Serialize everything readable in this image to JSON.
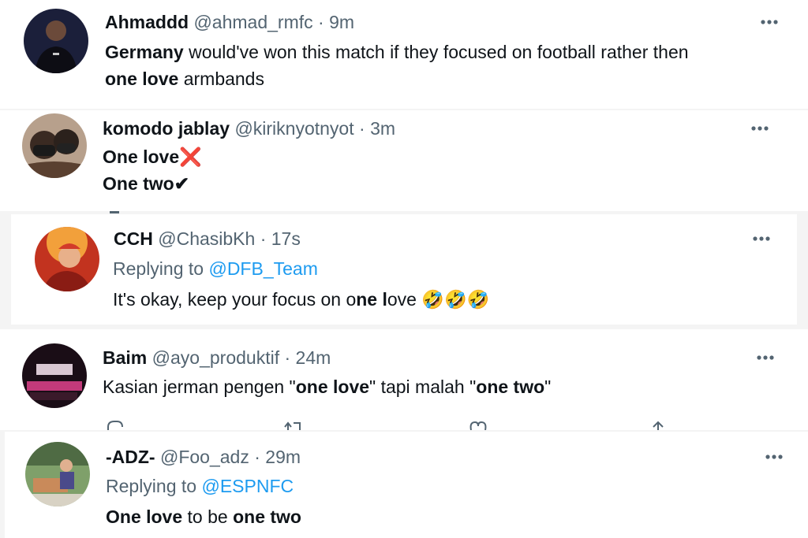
{
  "tweets": [
    {
      "name": "Ahmaddd",
      "handle": "@ahmad_rmfc",
      "time": "9m",
      "line1": [
        {
          "t": "Germany",
          "b": true
        },
        {
          "t": " would've won this match if they focused on football rather then",
          "b": false
        }
      ],
      "line2": [
        {
          "t": "one love",
          "b": true
        },
        {
          "t": " armbands",
          "b": false
        }
      ]
    },
    {
      "name": "komodo jablay",
      "handle": "@kiriknyotnyot",
      "time": "3m",
      "line1_text": "One love",
      "line1_emoji": "❌",
      "line2_text": "One two",
      "line2_emoji": "✔"
    },
    {
      "name": "CCH",
      "handle": "@ChasibKh",
      "time": "17s",
      "replying_prefix": "Replying to ",
      "replying_handle": "@DFB_Team",
      "body": [
        {
          "t": "It's okay,  keep your focus on o",
          "b": false
        },
        {
          "t": "ne l",
          "b": true
        },
        {
          "t": "ove ",
          "b": false
        }
      ],
      "emoji": "🤣🤣🤣"
    },
    {
      "name": "Baim",
      "handle": "@ayo_produktif",
      "time": "24m",
      "body": [
        {
          "t": "Kasian jerman pengen \"",
          "b": false
        },
        {
          "t": "one love",
          "b": true
        },
        {
          "t": "\" tapi malah \"",
          "b": false
        },
        {
          "t": "one two",
          "b": true
        },
        {
          "t": "\"",
          "b": false
        }
      ]
    },
    {
      "name": "-ADZ-",
      "handle": "@Foo_adz",
      "time": "29m",
      "replying_prefix": "Replying to ",
      "replying_handle": "@ESPNFC",
      "body": [
        {
          "t": "One love",
          "b": true
        },
        {
          "t": " to be ",
          "b": false
        },
        {
          "t": "one two",
          "b": true
        }
      ]
    }
  ],
  "separator": "·",
  "more_icon": "more-horizontal-icon",
  "action_icons": [
    "reply-icon",
    "retweet-icon",
    "like-icon",
    "share-icon"
  ],
  "colors": {
    "text": "#0f1419",
    "secondary": "#536471",
    "link": "#1d9bf0",
    "cross": "#e0245e"
  }
}
